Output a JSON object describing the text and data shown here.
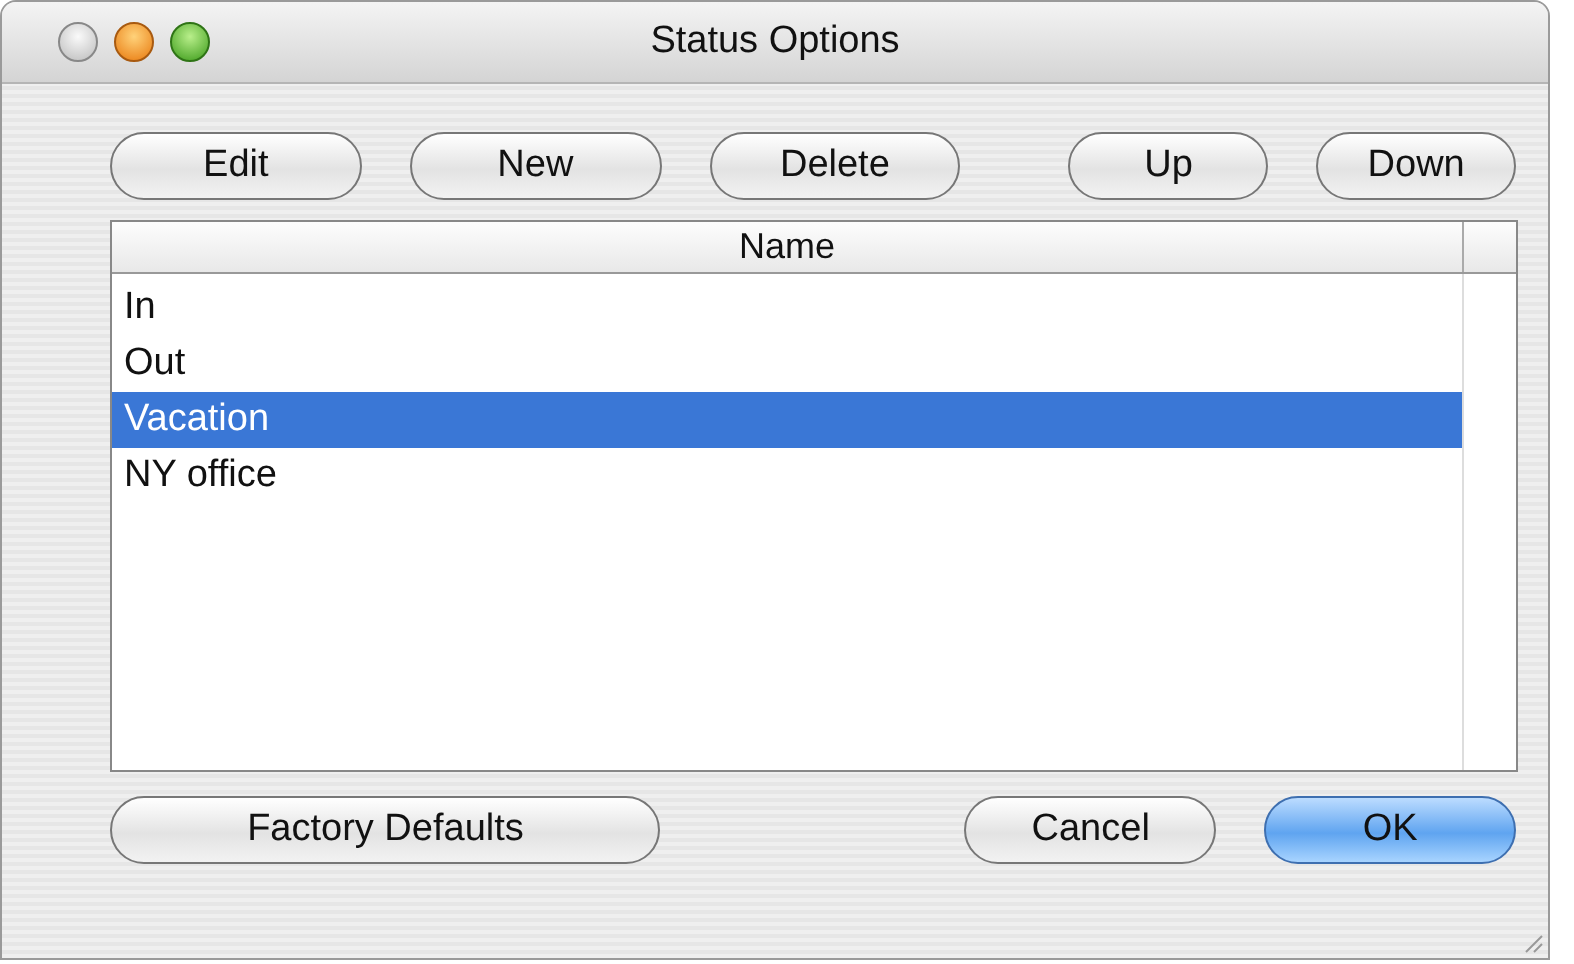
{
  "window": {
    "title": "Status Options"
  },
  "toolbar": [
    {
      "label": "Edit"
    },
    {
      "label": "New"
    },
    {
      "label": "Delete"
    },
    {
      "label": "Up"
    },
    {
      "label": "Down"
    }
  ],
  "table": {
    "columns": [
      "Name"
    ],
    "rows": [
      {
        "name": "In",
        "selected": false
      },
      {
        "name": "Out",
        "selected": false
      },
      {
        "name": "Vacation",
        "selected": true
      },
      {
        "name": "NY office",
        "selected": false
      }
    ]
  },
  "footer_buttons": [
    {
      "label": "Factory Defaults",
      "default": false
    },
    {
      "label": "Cancel",
      "default": false
    },
    {
      "label": "OK",
      "default": true
    }
  ]
}
